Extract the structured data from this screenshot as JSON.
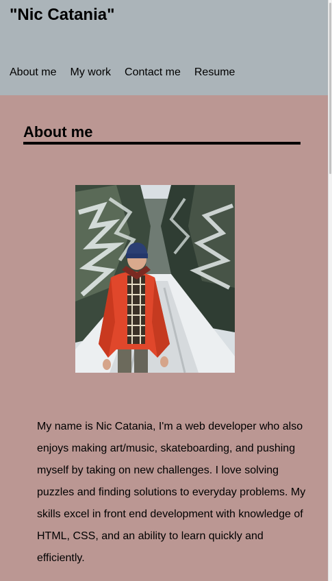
{
  "header": {
    "title": "\"Nic Catania\"",
    "nav": [
      {
        "label": "About me"
      },
      {
        "label": "My work"
      },
      {
        "label": "Contact me"
      },
      {
        "label": "Resume"
      }
    ]
  },
  "about": {
    "heading": "About me",
    "photo_icon": "portrait-photo",
    "bio": "My name is Nic Catania, I'm a web developer who also enjoys making art/music, skateboarding, and pushing myself by taking on new challenges. I love solving puzzles and finding solutions to everyday problems. My skills excel in front end development with knowledge of HTML, CSS, and an ability to learn quickly and efficiently."
  },
  "colors": {
    "header_bg": "#abb4b9",
    "main_bg": "#bb9793",
    "text": "#000000"
  }
}
